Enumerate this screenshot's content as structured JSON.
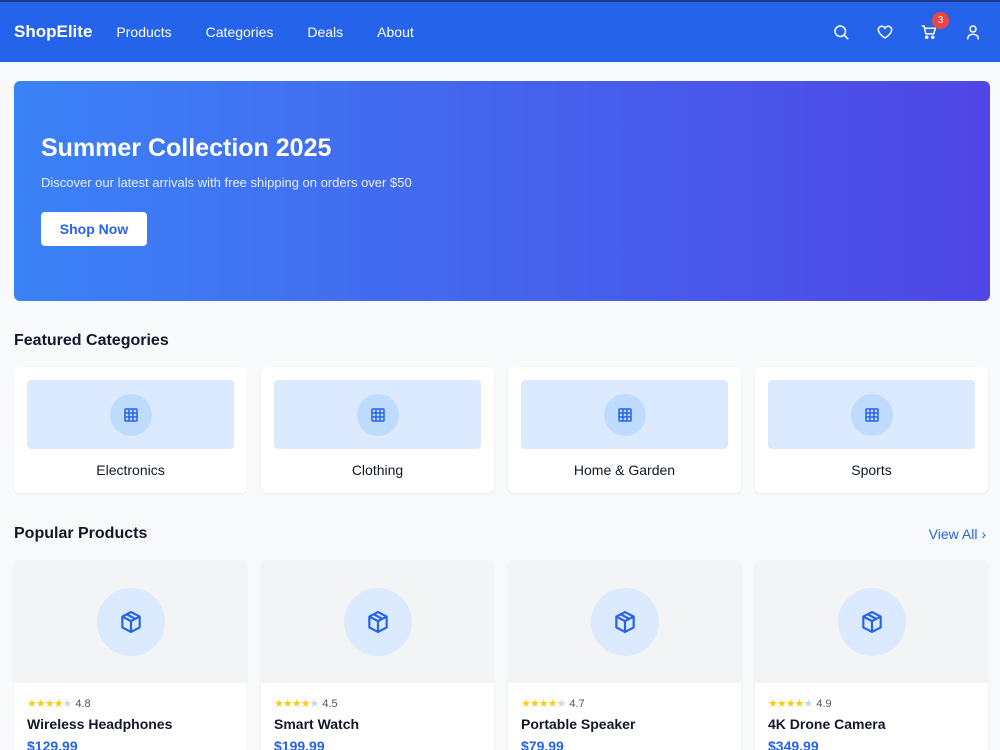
{
  "nav": {
    "brand": "ShopElite",
    "links": [
      "Products",
      "Categories",
      "Deals",
      "About"
    ],
    "icons": [
      "search-icon",
      "heart-icon",
      "cart-icon",
      "user-icon"
    ],
    "cart_count": "3"
  },
  "hero": {
    "title": "Summer Collection 2025",
    "subtitle": "Discover our latest arrivals with free shipping on orders over $50",
    "button": "Shop Now"
  },
  "categories": {
    "title": "Featured Categories",
    "items": [
      {
        "label": "Electronics",
        "icon": "grid-icon"
      },
      {
        "label": "Clothing",
        "icon": "grid-icon"
      },
      {
        "label": "Home & Garden",
        "icon": "grid-icon"
      },
      {
        "label": "Sports",
        "icon": "grid-icon"
      }
    ]
  },
  "products": {
    "title": "Popular Products",
    "view_all": "View All ›",
    "items": [
      {
        "name": "Wireless Headphones",
        "rating": "4.8",
        "stars": 4,
        "price": "$129.99",
        "icon": "box-icon"
      },
      {
        "name": "Smart Watch",
        "rating": "4.5",
        "stars": 4,
        "price": "$199.99",
        "icon": "box-icon"
      },
      {
        "name": "Portable Speaker",
        "rating": "4.7",
        "stars": 4,
        "price": "$79.99",
        "icon": "box-icon"
      },
      {
        "name": "4K Drone Camera",
        "rating": "4.9",
        "stars": 4,
        "price": "$349.99",
        "icon": "box-icon"
      }
    ]
  },
  "colors": {
    "primary": "#2563eb",
    "hero_start": "#3b82f6",
    "hero_end": "#4f46e5",
    "badge": "#ef4444",
    "star": "#facc15"
  }
}
